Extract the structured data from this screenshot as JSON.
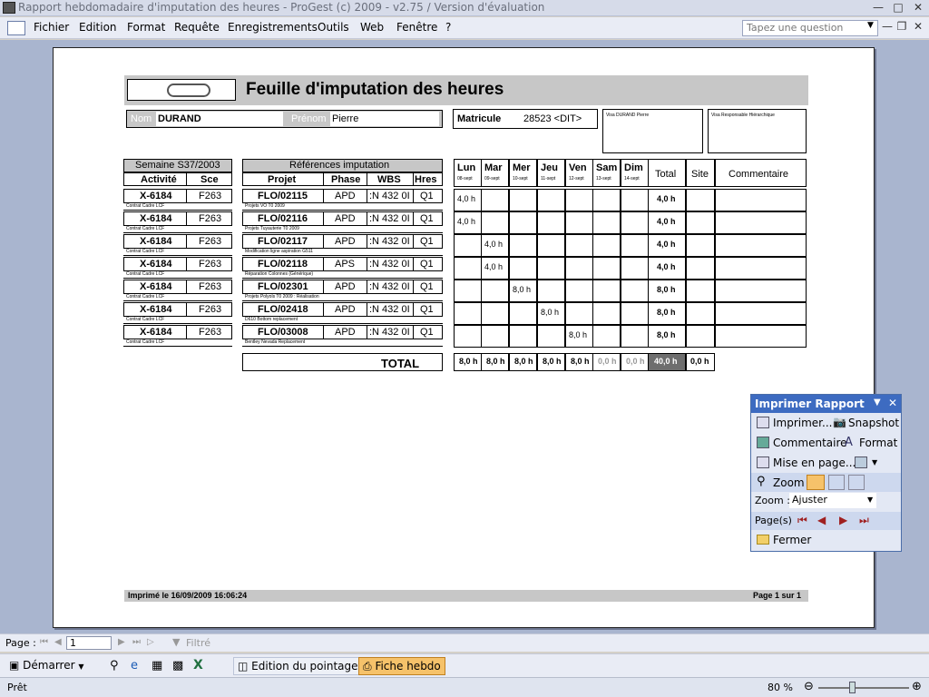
{
  "window": {
    "title": "Rapport hebdomadaire d'imputation des heures - ProGest (c) 2009 - v2.75 / Version d'évaluation"
  },
  "menu": {
    "items": [
      "Fichier",
      "Edition",
      "Format",
      "Requête",
      "Enregistrements",
      "Outils",
      "Web",
      "Fenêtre",
      "?"
    ],
    "ask_placeholder": "Tapez une question"
  },
  "report": {
    "title": "Feuille d'imputation des heures",
    "nom_label": "Nom",
    "nom_value": "DURAND",
    "prenom_label": "Prénom",
    "prenom_value": "Pierre",
    "matricule_label": "Matricule",
    "matricule_value": "28523 <DIT>",
    "visa1": "Visa DURAND Pierre",
    "visa2": "Visa Responsable Hiérarchique",
    "semaine_header": "Semaine S37/2003",
    "col_activite": "Activité",
    "col_sce": "Sce",
    "ref_header": "Références imputation",
    "col_projet": "Projet",
    "col_phase": "Phase",
    "col_wbs": "WBS",
    "col_hres": "Hres",
    "days": [
      {
        "name": "Lun",
        "date": "08-sept"
      },
      {
        "name": "Mar",
        "date": "09-sept"
      },
      {
        "name": "Mer",
        "date": "10-sept"
      },
      {
        "name": "Jeu",
        "date": "11-sept"
      },
      {
        "name": "Ven",
        "date": "12-sept"
      },
      {
        "name": "Sam",
        "date": "13-sept"
      },
      {
        "name": "Dim",
        "date": "14-sept"
      }
    ],
    "col_total": "Total",
    "col_site": "Site",
    "col_commentaire": "Commentaire",
    "rows": [
      {
        "activite": "X-6184",
        "sce": "F263",
        "sub": "Contrat Cadre LCF",
        "projet": "FLO/02115",
        "phase": "APD",
        "wbs": ":N 432 0I",
        "hres": "Q1",
        "projdesc": "Projets VO T0 2009",
        "hours": [
          "4,0 h",
          "",
          "",
          "",
          "",
          "",
          ""
        ],
        "total": "4,0 h"
      },
      {
        "activite": "X-6184",
        "sce": "F263",
        "sub": "Contrat Cadre LCF",
        "projet": "FLO/02116",
        "phase": "APD",
        "wbs": ":N 432 0I",
        "hres": "Q1",
        "projdesc": "Projets Tuyauterie T0 2009",
        "hours": [
          "4,0 h",
          "",
          "",
          "",
          "",
          "",
          ""
        ],
        "total": "4,0 h"
      },
      {
        "activite": "X-6184",
        "sce": "F263",
        "sub": "Contrat Cadre LCF",
        "projet": "FLO/02117",
        "phase": "APD",
        "wbs": ":N 432 0I",
        "hres": "Q1",
        "projdesc": "Modification ligne aspiration G511",
        "hours": [
          "",
          "4,0 h",
          "",
          "",
          "",
          "",
          ""
        ],
        "total": "4,0 h"
      },
      {
        "activite": "X-6184",
        "sce": "F263",
        "sub": "Contrat Cadre LCF",
        "projet": "FLO/02118",
        "phase": "APS",
        "wbs": ":N 432 0I",
        "hres": "Q1",
        "projdesc": "Réparation Colonnes (Générique)",
        "hours": [
          "",
          "4,0 h",
          "",
          "",
          "",
          "",
          ""
        ],
        "total": "4,0 h"
      },
      {
        "activite": "X-6184",
        "sce": "F263",
        "sub": "Contrat Cadre LCF",
        "projet": "FLO/02301",
        "phase": "APD",
        "wbs": ":N 432 0I",
        "hres": "Q1",
        "projdesc": "Projets Polyols T0 2009 : Réalisation",
        "hours": [
          "",
          "",
          "8,0 h",
          "",
          "",
          "",
          ""
        ],
        "total": "8,0 h"
      },
      {
        "activite": "X-6184",
        "sce": "F263",
        "sub": "Contrat Cadre LCF",
        "projet": "FLO/02418",
        "phase": "APD",
        "wbs": ":N 432 0I",
        "hres": "Q1",
        "projdesc": "D610 Bottom replacement",
        "hours": [
          "",
          "",
          "",
          "8,0 h",
          "",
          "",
          ""
        ],
        "total": "8,0 h"
      },
      {
        "activite": "X-6184",
        "sce": "F263",
        "sub": "Contrat Cadre LCF",
        "projet": "FLO/03008",
        "phase": "APD",
        "wbs": ":N 432 0I",
        "hres": "Q1",
        "projdesc": "Bentley Nevada Replacement",
        "hours": [
          "",
          "",
          "",
          "",
          "8,0 h",
          "",
          ""
        ],
        "total": "8,0 h"
      }
    ],
    "total_label": "TOTAL",
    "totals": [
      "8,0 h",
      "8,0 h",
      "8,0 h",
      "8,0 h",
      "8,0 h",
      "0,0 h",
      "0,0 h"
    ],
    "grand_total": "40,0 h",
    "site_total": "0,0 h",
    "printed": "Imprimé le 16/09/2009 16:06:24",
    "page": "Page 1 sur 1"
  },
  "print_panel": {
    "title": "Imprimer Rapport",
    "imprimer": "Imprimer...",
    "snapshot": "Snapshot",
    "commentaire": "Commentaire",
    "format": "Format",
    "mise_en_page": "Mise en page...",
    "zoom": "Zoom",
    "zoom_label": "Zoom :",
    "zoom_value": "Ajuster",
    "pages_label": "Page(s)",
    "fermer": "Fermer"
  },
  "navbar": {
    "page_label": "Page :",
    "page_value": "1",
    "filter": "Filtré"
  },
  "taskbar": {
    "start": "Démarrer",
    "task1": "Edition du pointage",
    "task2": "Fiche hebdo"
  },
  "status": {
    "text": "Prêt",
    "zoom": "80 %"
  }
}
